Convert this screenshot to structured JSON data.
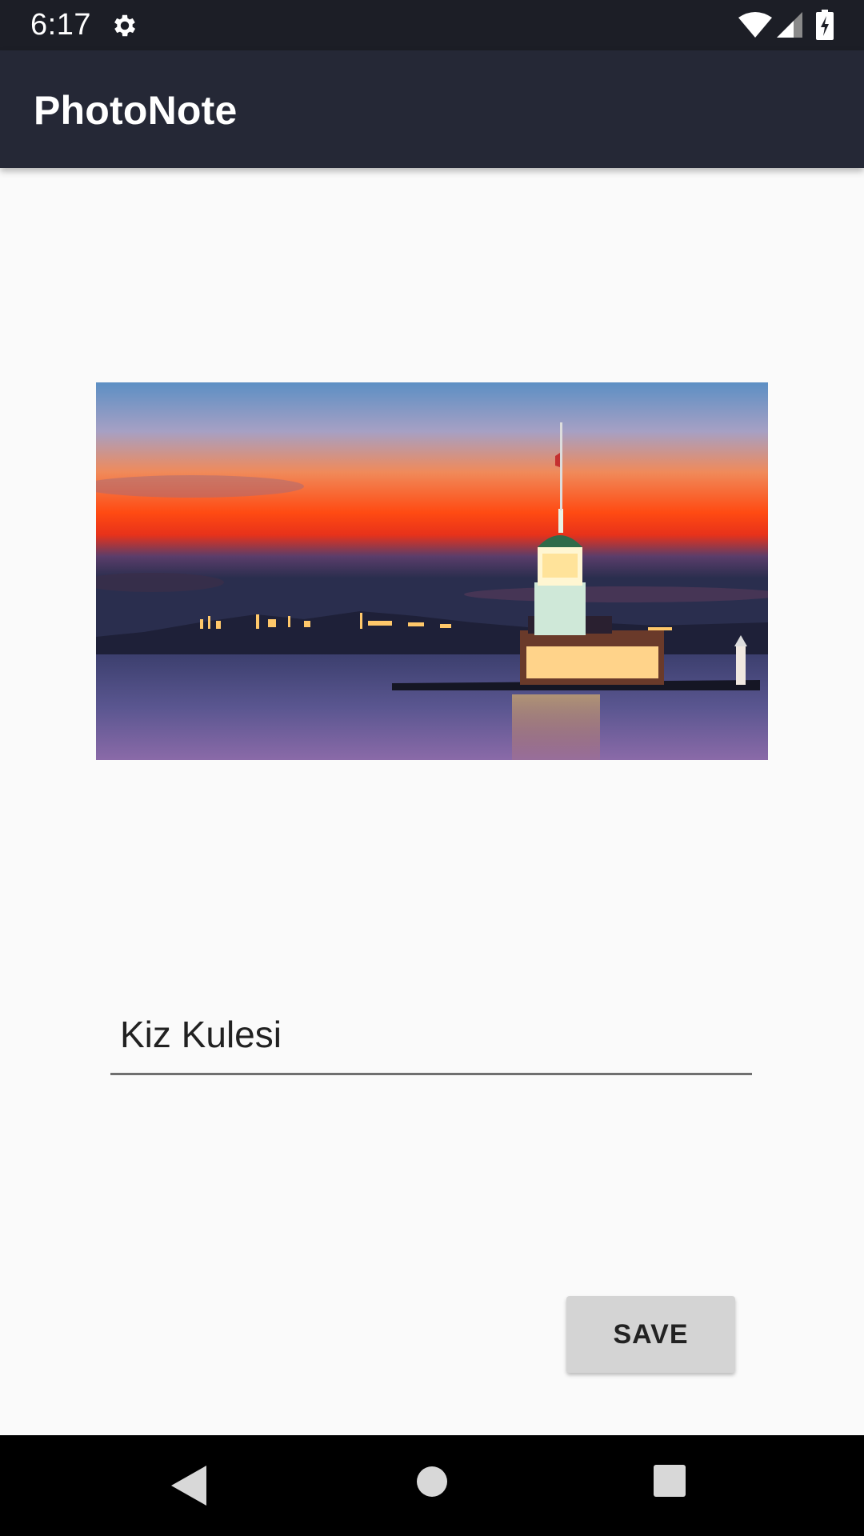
{
  "status_bar": {
    "time": "6:17",
    "icons": [
      "gear-icon",
      "wifi-icon",
      "cell-signal-icon",
      "battery-charging-icon"
    ]
  },
  "app_bar": {
    "title": "PhotoNote",
    "background": "#252836"
  },
  "photo": {
    "description_icon": "landscape-photo"
  },
  "note": {
    "value": "Kiz Kulesi",
    "placeholder": ""
  },
  "actions": {
    "save_label": "SAVE"
  },
  "nav_bar": {
    "icons": [
      "back-icon",
      "home-icon",
      "recents-icon"
    ]
  },
  "colors": {
    "status_bar": "#1c1e26",
    "app_bar": "#252836",
    "background": "#fafafa",
    "save_button": "#d4d4d4"
  }
}
